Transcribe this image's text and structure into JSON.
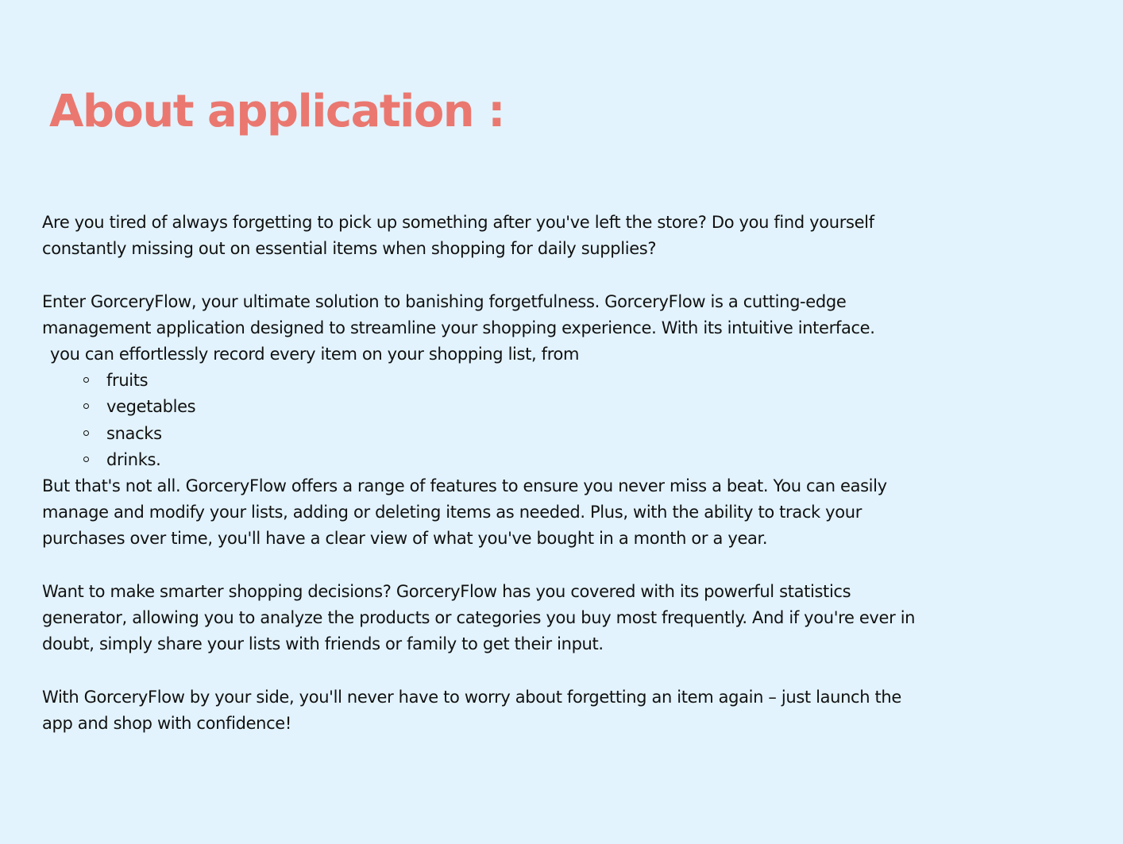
{
  "title": "About application :",
  "colors": {
    "background": "#e2f3fd",
    "title": "#ea7870",
    "text": "#111111"
  },
  "paragraphs": {
    "intro": [
      "Are you tired of always forgetting to pick up something after you've left the store? Do you find yourself",
      "constantly missing out on essential items when shopping for daily supplies?"
    ],
    "enter": [
      "Enter GorceryFlow, your ultimate solution to banishing forgetfulness. GorceryFlow is a cutting-edge",
      "management application designed to streamline your shopping experience. With its intuitive interface.",
      "you can effortlessly record every item on your shopping list, from"
    ],
    "items": [
      "fruits",
      "vegetables",
      "snacks",
      "drinks."
    ],
    "features": [
      "But that's not all. GorceryFlow offers a range of features to ensure you never miss a beat. You can easily",
      "manage and modify your lists, adding or deleting items as needed. Plus, with the ability to track your",
      "purchases over time, you'll have a clear view of what you've bought in a month or a year."
    ],
    "statistics": [
      "Want to make smarter shopping decisions? GorceryFlow has you covered with its powerful statistics",
      "generator, allowing you to analyze the products or categories you buy most frequently. And if you're ever in",
      "doubt, simply share your lists with friends or family to get their input."
    ],
    "closing": [
      "With GorceryFlow by your side, you'll never have to worry about forgetting an item again – just launch the",
      "app and shop with confidence!"
    ]
  }
}
